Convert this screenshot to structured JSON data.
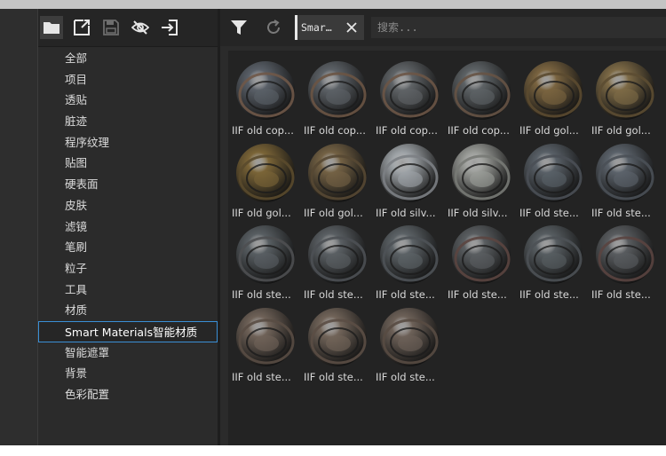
{
  "toolbar": {
    "icons": [
      "folder-icon",
      "new-window-icon",
      "save-icon",
      "hide-icon",
      "import-icon"
    ]
  },
  "categories": [
    {
      "label": "全部"
    },
    {
      "label": "项目"
    },
    {
      "label": "透贴"
    },
    {
      "label": "脏迹"
    },
    {
      "label": "程序纹理"
    },
    {
      "label": "贴图"
    },
    {
      "label": "硬表面"
    },
    {
      "label": "皮肤"
    },
    {
      "label": "滤镜"
    },
    {
      "label": "笔刷"
    },
    {
      "label": "粒子"
    },
    {
      "label": "工具"
    },
    {
      "label": "材质"
    },
    {
      "label": "Smart Materials智能材质",
      "selected": true
    },
    {
      "label": "智能遮罩"
    },
    {
      "label": "背景"
    },
    {
      "label": "色彩配置"
    }
  ],
  "library": {
    "filter_chip": "Smar…",
    "search_placeholder": "搜索..."
  },
  "materials": [
    {
      "label": "IIF old cop...",
      "color": "#5a6068",
      "rim": "#6f5848"
    },
    {
      "label": "IIF old cop...",
      "color": "#5c6166",
      "rim": "#6a5444"
    },
    {
      "label": "IIF old cop...",
      "color": "#5f6366",
      "rim": "#6b5546"
    },
    {
      "label": "IIF old cop...",
      "color": "#5d6265",
      "rim": "#665345"
    },
    {
      "label": "IIF old gol...",
      "color": "#7a6440",
      "rim": "#5b4a30"
    },
    {
      "label": "IIF old gol...",
      "color": "#7d6a46",
      "rim": "#5c4c32"
    },
    {
      "label": "IIF old gol...",
      "color": "#7a6437",
      "rim": "#5a4a2c"
    },
    {
      "label": "IIF old gol...",
      "color": "#736144",
      "rim": "#574833"
    },
    {
      "label": "IIF old silv...",
      "color": "#9da2a6",
      "rim": "#7c8084"
    },
    {
      "label": "IIF old silv...",
      "color": "#9a9c98",
      "rim": "#787a76"
    },
    {
      "label": "IIF old ste...",
      "color": "#596067",
      "rim": "#4a4f55"
    },
    {
      "label": "IIF old ste...",
      "color": "#5b626a",
      "rim": "#4a5057"
    },
    {
      "label": "IIF old ste...",
      "color": "#585e62",
      "rim": "#4e4f51"
    },
    {
      "label": "IIF old ste...",
      "color": "#5a5f63",
      "rim": "#4c5054"
    },
    {
      "label": "IIF old ste...",
      "color": "#5c6266",
      "rim": "#4e5256"
    },
    {
      "label": "IIF old ste...",
      "color": "#5a5e61",
      "rim": "#5b4540"
    },
    {
      "label": "IIF old ste...",
      "color": "#575d61",
      "rim": "#4d5155"
    },
    {
      "label": "IIF old ste...",
      "color": "#595c5f",
      "rim": "#5a4440"
    },
    {
      "label": "IIF old ste...",
      "color": "#6f6258",
      "rim": "#594c44"
    },
    {
      "label": "IIF old ste...",
      "color": "#716459",
      "rim": "#5b4e45"
    },
    {
      "label": "IIF old ste...",
      "color": "#6d6158",
      "rim": "#584b43"
    }
  ]
}
